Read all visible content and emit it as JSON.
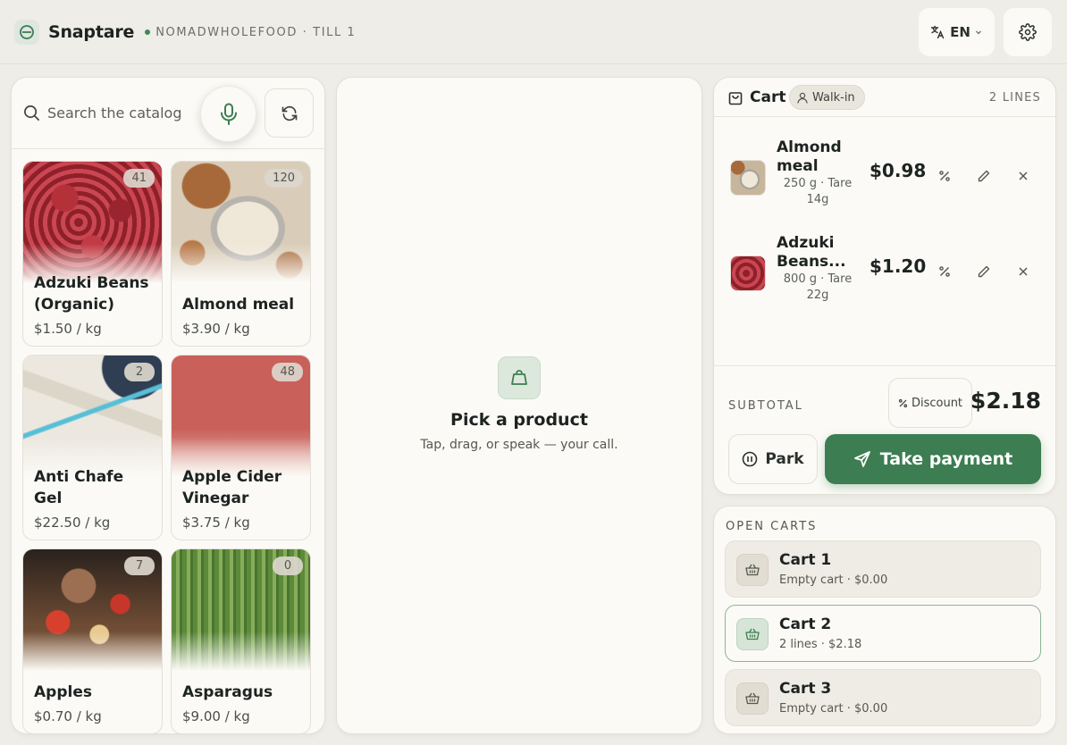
{
  "app": {
    "name": "Snaptare",
    "store": "NOMADWHOLEFOOD · TILL 1"
  },
  "header": {
    "language": "EN"
  },
  "search": {
    "placeholder": "Search the catalog"
  },
  "catalog": {
    "products": [
      {
        "name": "Adzuki Beans (Organic)",
        "price": "$1.50 / kg",
        "stock": "41"
      },
      {
        "name": "Almond meal",
        "price": "$3.90 / kg",
        "stock": "120"
      },
      {
        "name": "Anti Chafe Gel",
        "price": "$22.50 / kg",
        "stock": "2"
      },
      {
        "name": "Apple Cider Vinegar",
        "price": "$3.75 / kg",
        "stock": "48"
      },
      {
        "name": "Apples",
        "price": "$0.70 / kg",
        "stock": "7"
      },
      {
        "name": "Asparagus",
        "price": "$9.00 / kg",
        "stock": "0"
      }
    ]
  },
  "center": {
    "title": "Pick a product",
    "subtitle": "Tap, drag, or speak — your call."
  },
  "cart": {
    "title": "Cart",
    "customer": "Walk-in",
    "lines_count": "2 LINES",
    "lines": [
      {
        "name": "Almond meal",
        "detail": "250 g · Tare 14g",
        "price": "$0.98"
      },
      {
        "name": "Adzuki Beans...",
        "detail": "800 g · Tare 22g",
        "price": "$1.20"
      }
    ],
    "subtotal_label": "SUBTOTAL",
    "discount_label": "Discount",
    "subtotal": "$2.18",
    "park_label": "Park",
    "pay_label": "Take payment"
  },
  "open_carts": {
    "title": "OPEN CARTS",
    "items": [
      {
        "name": "Cart 1",
        "meta": "Empty cart · $0.00",
        "active": false
      },
      {
        "name": "Cart 2",
        "meta": "2 lines · $2.18",
        "active": true
      },
      {
        "name": "Cart 3",
        "meta": "Empty cart · $0.00",
        "active": false
      }
    ]
  },
  "colors": {
    "accent": "#3c7d51",
    "background": "#efede7",
    "panel": "#fbfaf6"
  }
}
